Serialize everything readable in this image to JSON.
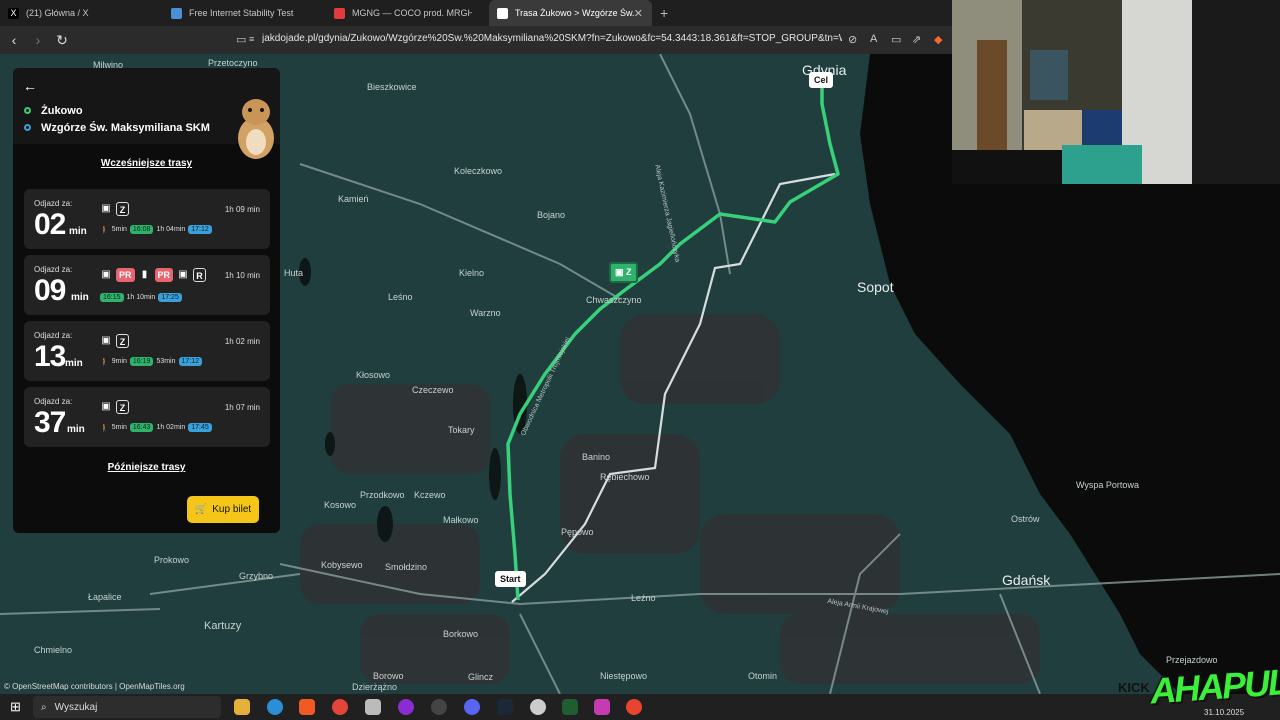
{
  "browser": {
    "tabs": [
      {
        "title": "(21) Główna / X",
        "color": "#ffffff"
      },
      {
        "title": "Free Internet Stability Test",
        "color": "#4a8fd8"
      },
      {
        "title": "MGNG — COCO prod. MRGH - YouT",
        "color": "#e23b3b"
      },
      {
        "title": "Trasa Żukowo > Wzgórze Św. M",
        "color": "#ffffff"
      }
    ],
    "url": "jakdojade.pl/gdynia/Żukowo/Wzgórze%20Św.%20Maksymiliana%20SKM?fn=Żukowo&fc=54.3443:18.361&ft=STOP_GROUP&tn=Wzg..."
  },
  "panel": {
    "from": "Żukowo",
    "to": "Wzgórze Św. Maksymiliana SKM",
    "earlier": "Wcześniejsze trasy",
    "later": "Późniejsze trasy",
    "buy": "Kup bilet",
    "routes": [
      {
        "label": "Odjazd za:",
        "minutes": "02",
        "unit": "min",
        "duration": "1h 09 min",
        "lines": [
          "Z"
        ],
        "walk": "5min",
        "dep": "16:08",
        "ride": "1h 04min",
        "arr": "17:12"
      },
      {
        "label": "Odjazd za:",
        "minutes": "09",
        "unit": "min",
        "duration": "1h 10 min",
        "lines": [
          "PR",
          "PR",
          "R"
        ],
        "walk": "",
        "dep": "16:15",
        "ride": "1h 10min",
        "arr": "17:25"
      },
      {
        "label": "Odjazd za:",
        "minutes": "13",
        "unit": "min",
        "duration": "1h 02 min",
        "lines": [
          "Z"
        ],
        "walk": "9min",
        "dep": "16:19",
        "ride": "53min",
        "arr": "17:12"
      },
      {
        "label": "Odjazd za:",
        "minutes": "37",
        "unit": "min",
        "duration": "1h 07 min",
        "lines": [
          "Z"
        ],
        "walk": "5min",
        "dep": "16:43",
        "ride": "1h 02min",
        "arr": "17:45"
      }
    ]
  },
  "map": {
    "pin_start": "Start",
    "pin_end": "Cel",
    "stop_line": "Z",
    "attribution": "© OpenStreetMap contributors | OpenMapTiles.org",
    "places": [
      {
        "name": "Gdynia",
        "big": true
      },
      {
        "name": "Sopot",
        "big": true
      },
      {
        "name": "Gdańsk",
        "big": true
      },
      {
        "name": "Milwino"
      },
      {
        "name": "Przetoczyno"
      },
      {
        "name": "Bieszkowice"
      },
      {
        "name": "Koleczkowo"
      },
      {
        "name": "Kamień"
      },
      {
        "name": "Bojano"
      },
      {
        "name": "Kielno"
      },
      {
        "name": "Leśno"
      },
      {
        "name": "Warzno"
      },
      {
        "name": "Chwaszczyno"
      },
      {
        "name": "Huta"
      },
      {
        "name": "Kłosowo"
      },
      {
        "name": "Czeczewo"
      },
      {
        "name": "Tokary"
      },
      {
        "name": "Banino"
      },
      {
        "name": "Rębiechowo"
      },
      {
        "name": "Przodkowo"
      },
      {
        "name": "Kczewo"
      },
      {
        "name": "Kosowo"
      },
      {
        "name": "Małkowo"
      },
      {
        "name": "Pępowo"
      },
      {
        "name": "Kobysewo"
      },
      {
        "name": "Smołdzino"
      },
      {
        "name": "Prokowo"
      },
      {
        "name": "Grzybno"
      },
      {
        "name": "Łapalice"
      },
      {
        "name": "Kartuzy"
      },
      {
        "name": "Chmielno"
      },
      {
        "name": "Borkowo"
      },
      {
        "name": "Borowo"
      },
      {
        "name": "Leźno"
      },
      {
        "name": "Dzierżążno"
      },
      {
        "name": "Glincz"
      },
      {
        "name": "Niestępowo"
      },
      {
        "name": "Otomin"
      },
      {
        "name": "Wyspa Portowa"
      },
      {
        "name": "Ostrów"
      },
      {
        "name": "Przejazdowo"
      }
    ],
    "roads": [
      "Aleja Kazimierza Jagiellończyka",
      "Obwodnica Metropolii Trójmiejskiej",
      "Aleja Armii Krajowej",
      "Obwodnica Metropolii Trójm"
    ]
  },
  "taskbar": {
    "search": "Wyszukaj",
    "date": "31.10.2025",
    "brand": "AHAPULCO",
    "kick": "KICK"
  }
}
